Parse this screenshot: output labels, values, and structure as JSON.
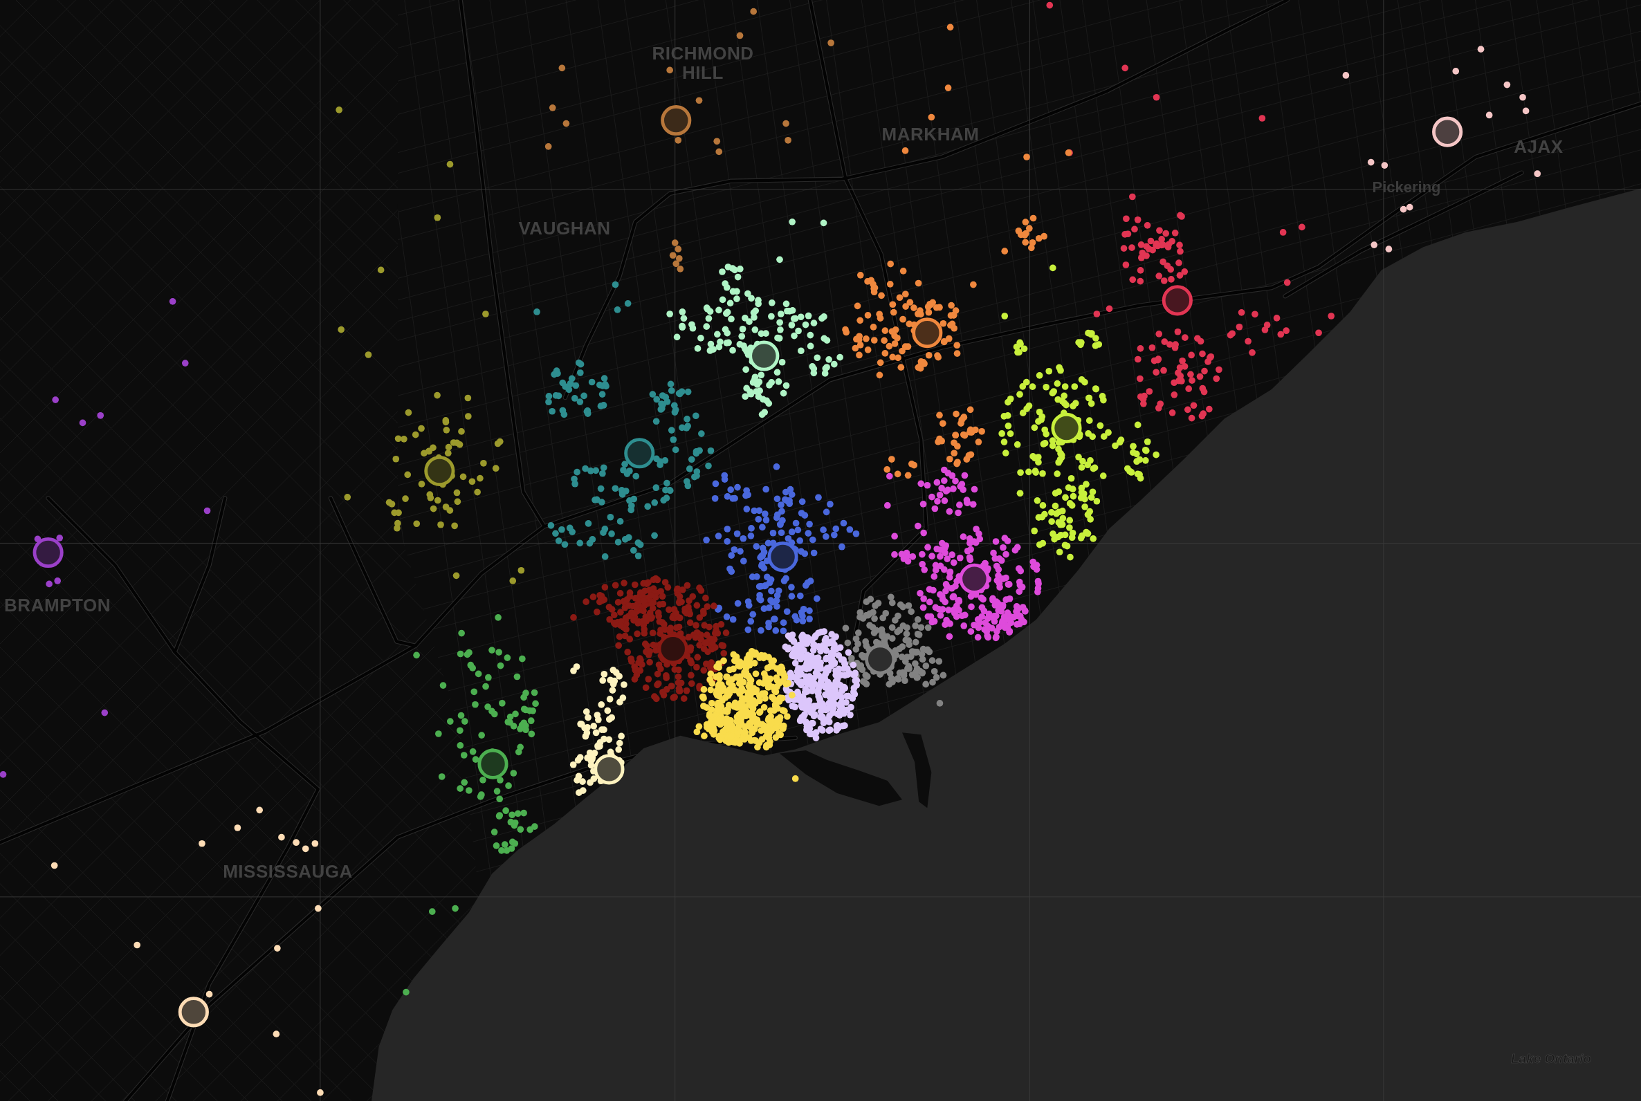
{
  "map": {
    "place_labels": [
      {
        "text": "RICHMOND HILL",
        "kind": "city"
      },
      {
        "text": "MARKHAM",
        "kind": "city"
      },
      {
        "text": "AJAX",
        "kind": "city"
      },
      {
        "text": "Pickering",
        "kind": "town"
      },
      {
        "text": "VAUGHAN",
        "kind": "city"
      },
      {
        "text": "BRAMPTON",
        "kind": "city"
      },
      {
        "text": "MISSISSAUGA",
        "kind": "city"
      },
      {
        "text": "Lake Ontario",
        "kind": "water"
      }
    ],
    "clusters": [
      {
        "color": "#b8773b"
      },
      {
        "color": "#f5c6c6"
      },
      {
        "color": "#e23553"
      },
      {
        "color": "#f0883e"
      },
      {
        "color": "#b0f4c6"
      },
      {
        "color": "#c8f03c"
      },
      {
        "color": "#2e8e90"
      },
      {
        "color": "#9c9a2c"
      },
      {
        "color": "#9b40c9"
      },
      {
        "color": "#4a68dd"
      },
      {
        "color": "#de4bdb"
      },
      {
        "color": "#8b1a14"
      },
      {
        "color": "#828282"
      },
      {
        "color": "#dcc6fb"
      },
      {
        "color": "#f9dc4c"
      },
      {
        "color": "#4caf50"
      },
      {
        "color": "#fdf2bf"
      },
      {
        "color": "#fddcb5"
      }
    ]
  }
}
